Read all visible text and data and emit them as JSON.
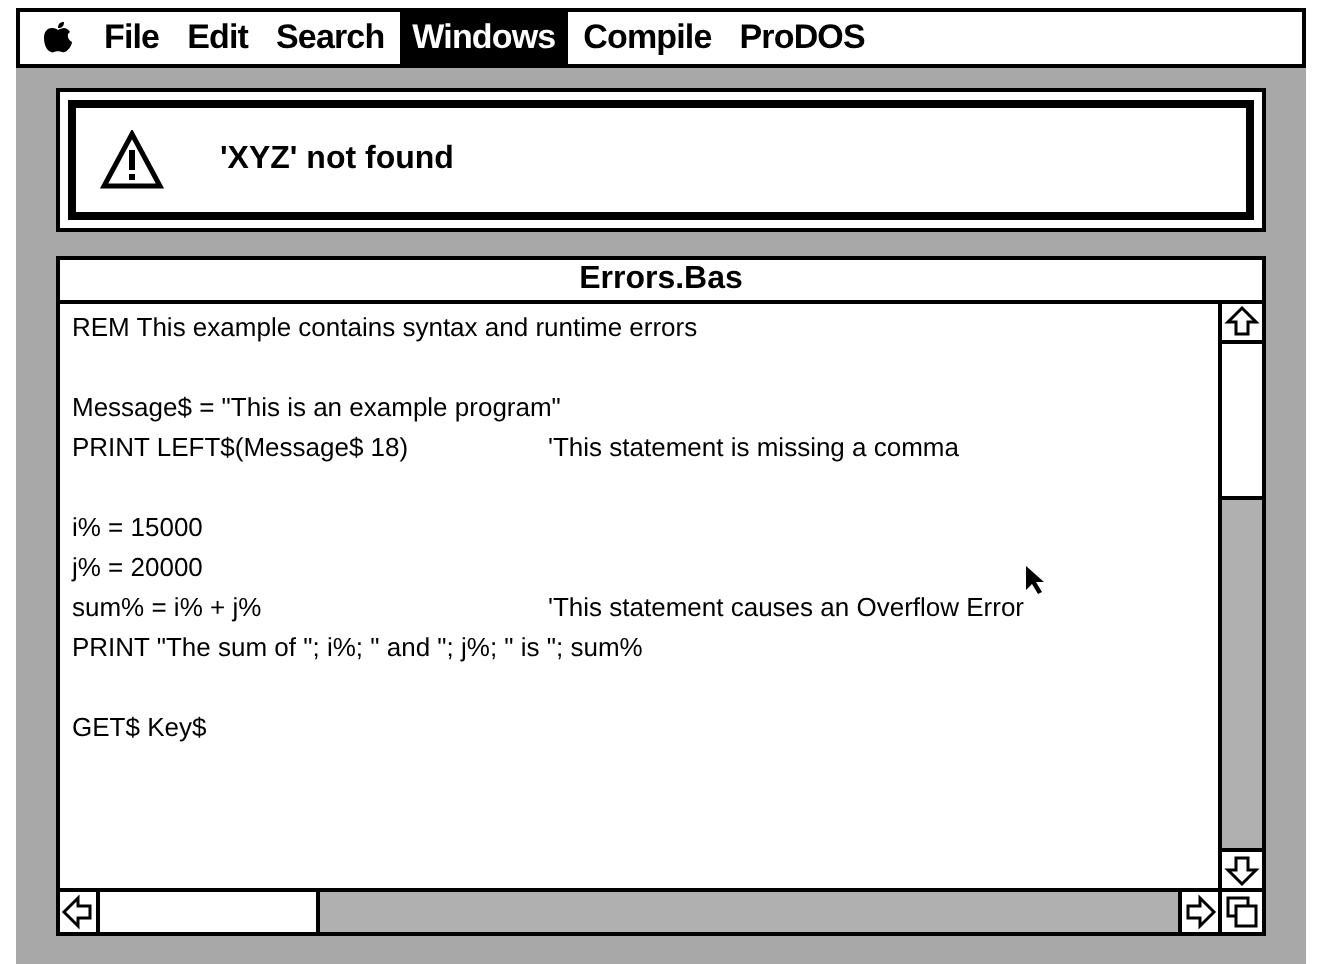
{
  "menu_bar": {
    "items": [
      {
        "label": "File",
        "selected": false
      },
      {
        "label": "Edit",
        "selected": false
      },
      {
        "label": "Search",
        "selected": false
      },
      {
        "label": "Windows",
        "selected": true
      },
      {
        "label": "Compile",
        "selected": false
      },
      {
        "label": "ProDOS",
        "selected": false
      }
    ]
  },
  "alert": {
    "message": "'XYZ' not found"
  },
  "window": {
    "title": "Errors.Bas",
    "lines": [
      {
        "code": "REM This example contains syntax and runtime errors",
        "blank_before": false
      },
      {
        "code": "Message$ = \"This is an example program\"",
        "blank_before": true
      },
      {
        "code": "PRINT LEFT$(Message$ 18)",
        "comment": "'This statement is missing a comma",
        "blank_before": false
      },
      {
        "code": "i% = 15000",
        "blank_before": true
      },
      {
        "code": "j% = 20000",
        "blank_before": false
      },
      {
        "code": "sum% = i% + j%",
        "comment": "'This statement causes an Overflow Error",
        "blank_before": false
      },
      {
        "code": "PRINT \"The sum of \"; i%; \" and \"; j%; \" is \"; sum%",
        "blank_before": false
      },
      {
        "code": "GET$ Key$",
        "blank_before": true
      }
    ]
  }
}
